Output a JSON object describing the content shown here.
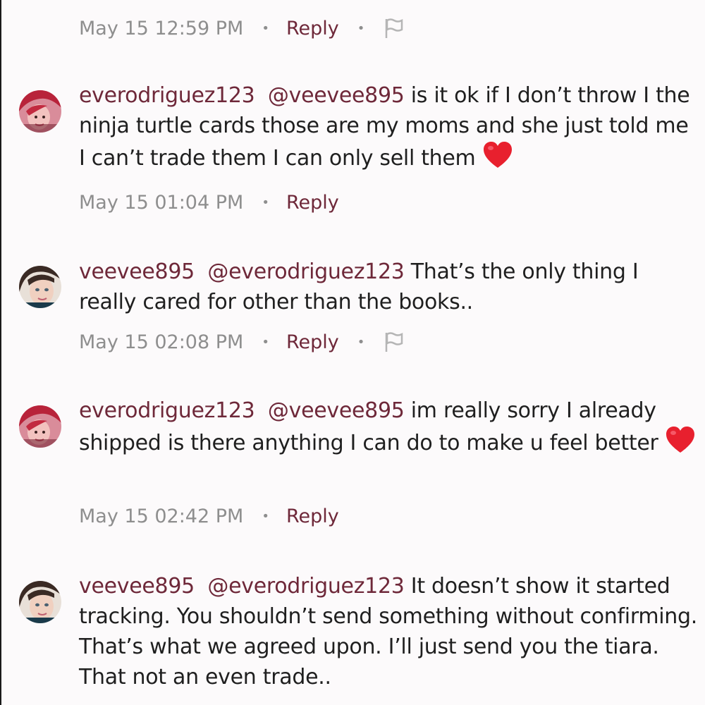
{
  "labels": {
    "reply": "Reply",
    "bullet": "•"
  },
  "icons": {
    "flag": "flag-icon",
    "heart": "heart-emoji"
  },
  "colors": {
    "username": "#6e2839",
    "timestamp": "#8e8e8e",
    "text": "#1f1f1f",
    "heart": "#e8202e"
  },
  "top_meta": {
    "timestamp": "May 15 12:59 PM"
  },
  "comments": [
    {
      "username": "everodriguez123",
      "mention": "@veevee895",
      "text": " is it ok if I don’t throw I the ninja turtle cards those are my moms and she just told me I can’t trade them I can only sell them ",
      "timestamp": "May 15 01:04 PM"
    },
    {
      "username": "veevee895",
      "mention": "@everodriguez123",
      "text": " That’s the only thing I really cared for other than the books..",
      "timestamp": "May 15 02:08 PM"
    },
    {
      "username": "everodriguez123",
      "mention": "@veevee895",
      "text": " im really sorry I already shipped is there anything I can do to make u feel better ",
      "timestamp": "May 15 02:42 PM"
    },
    {
      "username": "veevee895",
      "mention": "@everodriguez123",
      "text": " It doesn’t show it started tracking. You shouldn’t send something without confirming. That’s what we agreed upon. I’ll just send you the tiara. That not an even trade.."
    }
  ]
}
